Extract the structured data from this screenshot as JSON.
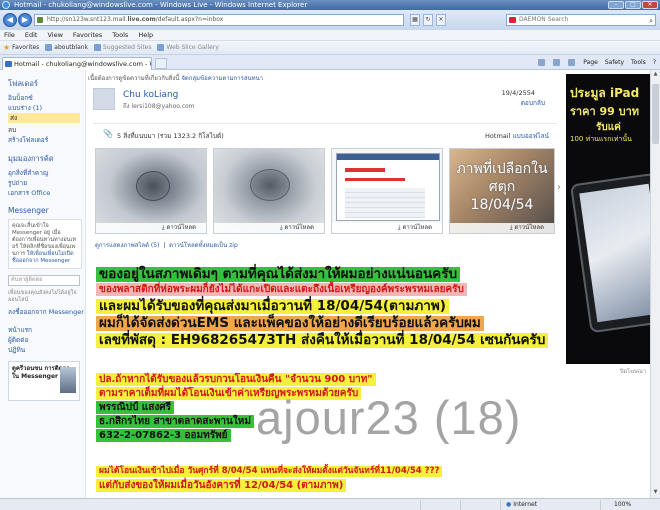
{
  "window": {
    "title": "Hotmail - chukoliang@windowslive.com - Windows Live - Windows Internet Explorer"
  },
  "addressbar": {
    "url_prefix": "http://sn123w.snt123.mail.",
    "url_domain": "live.com",
    "url_suffix": "/default.aspx?n=inbox",
    "search_placeholder": "DAEMON Search"
  },
  "menu": [
    "File",
    "Edit",
    "View",
    "Favorites",
    "Tools",
    "Help"
  ],
  "favorites": {
    "label": "Favorites",
    "items": [
      "aboutblank",
      "Suggested Sites",
      "Web Slice Gallery"
    ]
  },
  "tab": {
    "label": "Hotmail - chukoliang@windowslive.com - Windows Live"
  },
  "commandbar": [
    "Page",
    "Safety",
    "Tools"
  ],
  "sidebar": {
    "folders_heading": "โฟลเดอร์",
    "folders": [
      {
        "label": "อินบ็อกซ์",
        "selected": false
      },
      {
        "label": "แบบร่าง (1)",
        "selected": false
      },
      {
        "label": "ส่ง",
        "selected": true
      },
      {
        "label": "ลบ",
        "selected": false
      }
    ],
    "new_folder": "สร้างโฟลเดอร์",
    "quick_heading": "มุมมองการค้ด",
    "quick": [
      "อุกสิ่งที่สำคาญ",
      "รูปถ่าย",
      "เอกสาร Office"
    ],
    "messenger_heading": "Messenger",
    "messenger_text": "คุณจะลื่นเข้าใจ Messenger อยู่ เมื่อต้องการเพื่อนทานทางอนเทอร์ ให้คลิกที่ชื่อของเพื่อนเพนการ",
    "messenger_link": "ให้เพื่อนเพื่อนไม่เปิด",
    "messenger_link2": "ชื่อออกจาก Messenger",
    "contact_search_placeholder": "ค้นหาผู้ติดต่อ",
    "contacts_note": "เพื่อนของคุณยังคงไม่ได้อยู่ใจออนไลน์",
    "signout": "ลงชื่อออกจาก Messenger",
    "bottom_links": [
      "หน้าแรก",
      "ผู้ติดต่อ",
      "ปฏิทิน"
    ],
    "promo": "ดูครีวอนขน การติดตาใน Messenger"
  },
  "message": {
    "notice": "เนื้อต้องการดูข้อความที่เกี่ยวกับสิ่งนี้",
    "notice_link": "จัดกลุ่มข้อความตามการสนทนา",
    "sender": "Chu koLiang",
    "recipient": "ถึง lersi108@yahoo.com",
    "date": "19/4/2554",
    "reply": "ตอบกลับ",
    "attachments_count": "5 สิ่งที่แนบมา (รวม 1323.2 กิโลไบต์)",
    "hotmail_label": "Hotmail",
    "hotmail_link": "แบบออฟไลน์",
    "download_label": "ดาวน์โหลด",
    "thumb4_caption": [
      "ภาพที่เปลือกใน",
      "ศตุก",
      "18/04/54"
    ],
    "slideshow_link": "ดูการแสดงภาพสไลด์ (5)",
    "download_all_link": "ดาวน์โหลดทั้งหมดเป็น zip",
    "body": {
      "line1": "ของอยู่ในสภาพเดิมๆ ตามที่คุณได้ส่งมาให้ผมอย่างแน่นอนครับ",
      "line2": "ของพลาสติกที่ห่อพระผมก็ยังไม่ได้แกะเปิดและแตะถึงเนื้อเหรียญองค์พระพรหมเลยครับ",
      "line3": "และผมได้รับของที่คุณส่งมาเมื่อวานที่ 18/04/54(ตามภาพ)",
      "line4": "ผมก็ได้จัดส่งด่วนEMS และแพ็คของให้อย่างดีเรียบร้อยแล้วครับผม",
      "line5": "เลขที่พัสดุ : EH968265473TH ส่งคืนให้เมื่อวานที่ 18/04/54 เซนกันครับ",
      "line6": "ปล.ถ้าหากได้รับของแล้วรบกวนโอนเงินคืน \"จำนวน 900 บาท\"",
      "line7": "ตามราคาเต็มที่ผมได้โอนเงินเข้าค่าเหรียญพระพรหมด้วยครับ",
      "line8": "พรรณิปป์ แสงศรี",
      "line9": "ธ.กสิกรไทย สาขาตลาดสะพานใหม่",
      "line10": "632-2-07862-3 ออมทรัพย์",
      "line11": "ผมได้โอนเงินเข้าไปเมื่อ วันศุกร์ที่ 8/04/54 แทนที่จะส่งให้ผมตั้งแต่วันจันทร์ที่11/04/54 ???",
      "line12": "แต่กับส่งของให้ผมเมื่อวันอังคารที่ 12/04/54 (ตามภาพ)"
    }
  },
  "watermark": "ajour23 (18)",
  "ad": {
    "line1": "ประมูล iPad",
    "line2": "ราคา 99 บาท",
    "line3": "รับแค่",
    "line4": "100 ท่านแรกเท่านั้น",
    "label": "ปิดโฆษณา"
  },
  "status": {
    "zone": "Internet",
    "zoom": "100%"
  }
}
